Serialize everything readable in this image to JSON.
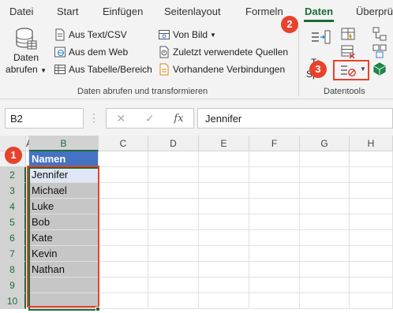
{
  "ribbon_tabs": [
    "Datei",
    "Start",
    "Einfügen",
    "Seitenlayout",
    "Formeln",
    "Daten",
    "Überprüfen"
  ],
  "active_tab": "Daten",
  "get_transform": {
    "big_button_line1": "Daten",
    "big_button_line2": "abrufen",
    "text_csv": "Aus Text/CSV",
    "from_web": "Aus dem Web",
    "from_table": "Aus Tabelle/Bereich",
    "from_image": "Von Bild",
    "recent_sources": "Zuletzt verwendete Quellen",
    "existing_connections": "Vorhandene Verbindungen",
    "group_label": "Daten abrufen und transformieren"
  },
  "data_tools": {
    "partial_text_1": "Te",
    "partial_text_2": "Sp",
    "group_label": "Datentools"
  },
  "callouts": [
    "1",
    "2",
    "3"
  ],
  "formula_bar": {
    "name_box": "B2",
    "cancel_symbol": "✕",
    "enter_symbol": "✓",
    "fx_label": "fx",
    "formula": "Jennifer"
  },
  "grid": {
    "columns": [
      "A",
      "B",
      "C",
      "D",
      "E",
      "F",
      "G",
      "H"
    ],
    "rows": [
      "1",
      "2",
      "3",
      "4",
      "5",
      "6",
      "7",
      "8",
      "9",
      "10"
    ],
    "header_cell": "Namen",
    "names": [
      "Jennifer",
      "Michael",
      "Luke",
      "Bob",
      "Kate",
      "Kevin",
      "Nathan",
      "",
      ""
    ]
  },
  "colors": {
    "accent_green": "#1e6b3a",
    "callout_red": "#e8412c",
    "header_blue": "#4472c4",
    "selection_gray": "#c6c6c6"
  }
}
